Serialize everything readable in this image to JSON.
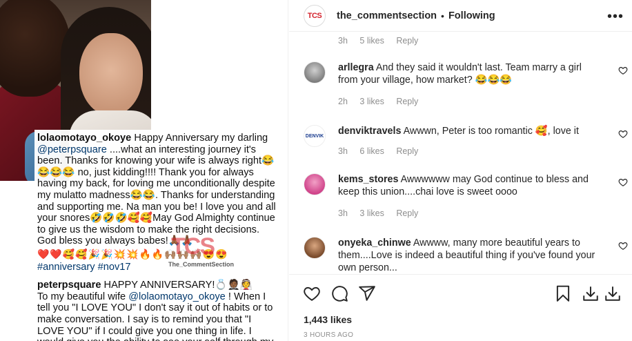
{
  "post": {
    "account_handle": "the_commentsection",
    "follow_status": "Following",
    "separator": "•",
    "logo_text": "TCS",
    "likes_text": "1,443 likes",
    "timestamp": "3 HOURS AGO"
  },
  "image_caption": {
    "user1": "lolaomotayo_okoye",
    "text1": "Happy Anniversary my darling",
    "mention1": "@peterpsquare",
    "text1b": "....what an interesting journey it's been. Thanks for knowing your wife is always right😂😂😂😂 no, just kidding!!!! Thank you for always having my back, for loving me unconditionally despite my mulatto madness😂😂. Thanks for understanding and supporting me. Na man you be! I love you and all your snores🤣🤣🤣🥰🥰May God Almighty continue to give us the wisdom to make the right decisions. God bless you always babes!🙏🏾🙏🏾",
    "emoji_line": "❤️❤️🥰🥰🎉🎉💥💥🔥🔥🙌🏽🙌🏽🙌🏽😍😍",
    "hashtags": "#anniversary #nov17",
    "user2": "peterpsquare",
    "text2": "HAPPY ANNIVERSARY!💍🤵🏾👰",
    "text2b": "To my beautiful wife",
    "mention2": "@lolaomotayo_okoye",
    "text2c": "! When I tell you \"I LOVE YOU\" I don't say it out of habits or to make conversation. I say is to remind you that \"I LOVE YOU\" if I could give you one thing in life. I would give you the ability to see your self through my",
    "watermark_logo": "TCS",
    "watermark_text": "The_CommentSection"
  },
  "top_meta": {
    "time": "3h",
    "likes": "5 likes",
    "reply": "Reply"
  },
  "comments": [
    {
      "user": "arllegra",
      "text": "And they said it wouldn't last. Team marry a girl from your village, how market? 😂😂😂",
      "time": "2h",
      "likes": "3 likes",
      "reply": "Reply"
    },
    {
      "user": "denviktravels",
      "text": "Awwwn, Peter is too romantic 🥰, love it",
      "time": "3h",
      "likes": "6 likes",
      "reply": "Reply",
      "avatar_text": "DENVIK"
    },
    {
      "user": "kems_stores",
      "text": "Awwwwww may God continue to bless and keep this union....chai love is sweet oooo",
      "time": "3h",
      "likes": "3 likes",
      "reply": "Reply"
    },
    {
      "user": "onyeka_chinwe",
      "text": "Awwww, many more beautiful years to them....Love is indeed a beautiful thing if you've found your own person...",
      "time": "",
      "likes": "",
      "reply": ""
    }
  ],
  "icons": [
    "heart-icon",
    "comment-icon",
    "share-icon",
    "bookmark-icon",
    "download-icon",
    "download-icon"
  ]
}
